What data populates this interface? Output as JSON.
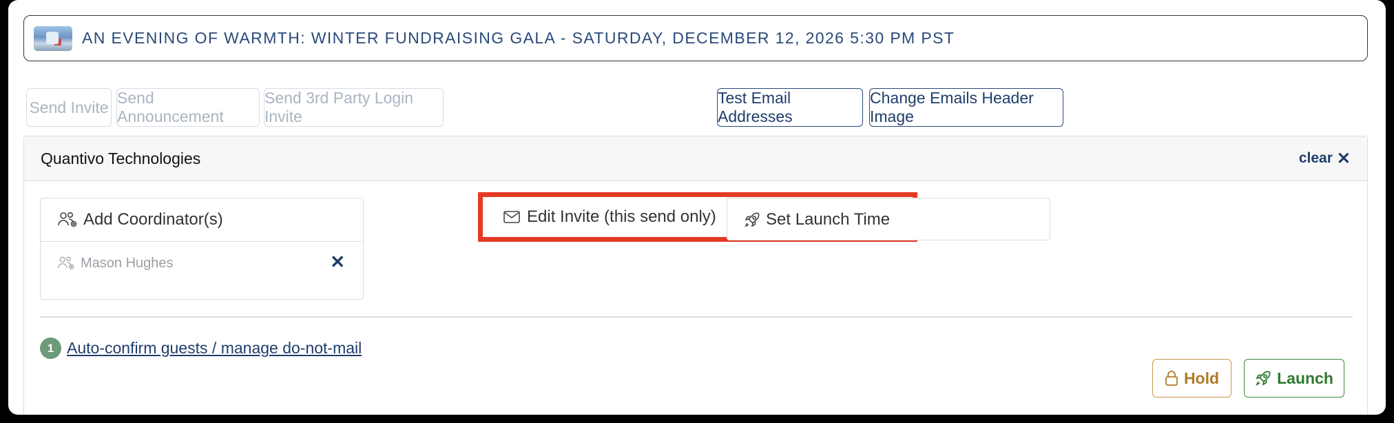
{
  "event": {
    "title": "AN EVENING OF WARMTH: WINTER FUNDRAISING GALA - SATURDAY, DECEMBER 12, 2026 5:30 PM PST"
  },
  "toolbar": {
    "send_invite": "Send Invite",
    "send_announcement": "Send Announcement",
    "send_3rd_party": "Send 3rd Party Login Invite",
    "test_emails": "Test Email Addresses",
    "change_header": "Change Emails Header Image"
  },
  "panel": {
    "title": "Quantivo Technologies",
    "clear_label": "clear",
    "clear_icon": "✕"
  },
  "coordinators": {
    "header": "Add Coordinator(s)",
    "items": [
      {
        "name": "Mason Hughes",
        "remove_icon": "✕"
      }
    ]
  },
  "edit_invite": {
    "label": "Edit Invite (this send only)"
  },
  "launch_time": {
    "label": "Set Launch Time"
  },
  "step": {
    "number": "1",
    "link": "Auto-confirm guests / manage do-not-mail"
  },
  "actions": {
    "hold": "Hold",
    "launch": "Launch"
  },
  "colors": {
    "primary": "#1f3d6b",
    "highlight": "#e43b24",
    "hold": "#b07a2a",
    "launch": "#2e7a2e",
    "badge": "#6d9a7a"
  }
}
